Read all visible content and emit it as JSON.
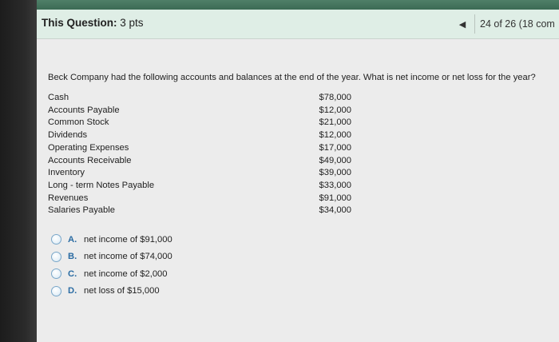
{
  "header": {
    "title_bold": "This Question:",
    "title_points": "3 pts",
    "progress": "24 of 26 (18 com",
    "prev_icon": "left-triangle-icon"
  },
  "question": {
    "text": "Beck Company had the following accounts and balances at the end of the year. What is net income or net loss for the year?",
    "accounts": [
      {
        "name": "Cash",
        "amount": "$78,000"
      },
      {
        "name": "Accounts Payable",
        "amount": "$12,000"
      },
      {
        "name": "Common Stock",
        "amount": "$21,000"
      },
      {
        "name": "Dividends",
        "amount": "$12,000"
      },
      {
        "name": "Operating Expenses",
        "amount": "$17,000"
      },
      {
        "name": "Accounts Receivable",
        "amount": "$49,000"
      },
      {
        "name": "Inventory",
        "amount": "$39,000"
      },
      {
        "name": "Long - term Notes Payable",
        "amount": "$33,000"
      },
      {
        "name": "Revenues",
        "amount": "$91,000"
      },
      {
        "name": "Salaries Payable",
        "amount": "$34,000"
      }
    ],
    "options": [
      {
        "letter": "A.",
        "text": "net income of $91,000"
      },
      {
        "letter": "B.",
        "text": "net income of $74,000"
      },
      {
        "letter": "C.",
        "text": "net income of $2,000"
      },
      {
        "letter": "D.",
        "text": "net loss of $15,000"
      }
    ]
  }
}
